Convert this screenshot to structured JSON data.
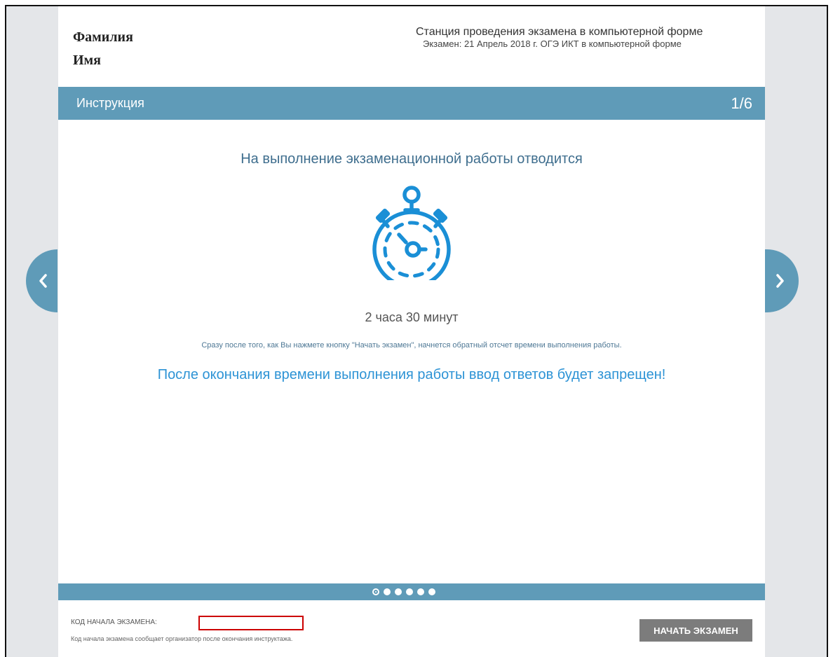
{
  "student": {
    "surname": "Фамилия",
    "name": "Имя"
  },
  "station": {
    "title": "Станция проведения экзамена в компьютерной форме",
    "exam": "Экзамен: 21 Апрель 2018 г. ОГЭ ИКТ в компьютерной форме"
  },
  "header": {
    "title": "Инструкция",
    "page_counter": "1/6"
  },
  "content": {
    "lead": "На выполнение экзаменационной работы отводится",
    "icon": "stopwatch-icon",
    "duration": "2 часа 30 минут",
    "hint": "Сразу после того, как Вы нажмете кнопку \"Начать экзамен\", начнется обратный отсчет времени выполнения работы.",
    "warning": "После окончания времени выполнения работы ввод ответов будет запрещен!"
  },
  "pagination": {
    "total": 6,
    "current": 1
  },
  "footer": {
    "code_label": "КОД НАЧАЛА ЭКЗАМЕНА:",
    "code_value": "",
    "code_hint": "Код начала экзамена сообщает организатор после окончания инструктажа.",
    "start_label": "НАЧАТЬ ЭКЗАМЕН"
  },
  "colors": {
    "bar": "#5f9bb8",
    "icon": "#1a8fd6",
    "warning": "#2d93d5",
    "button": "#7c7c7c",
    "input_border": "#cc0000"
  }
}
